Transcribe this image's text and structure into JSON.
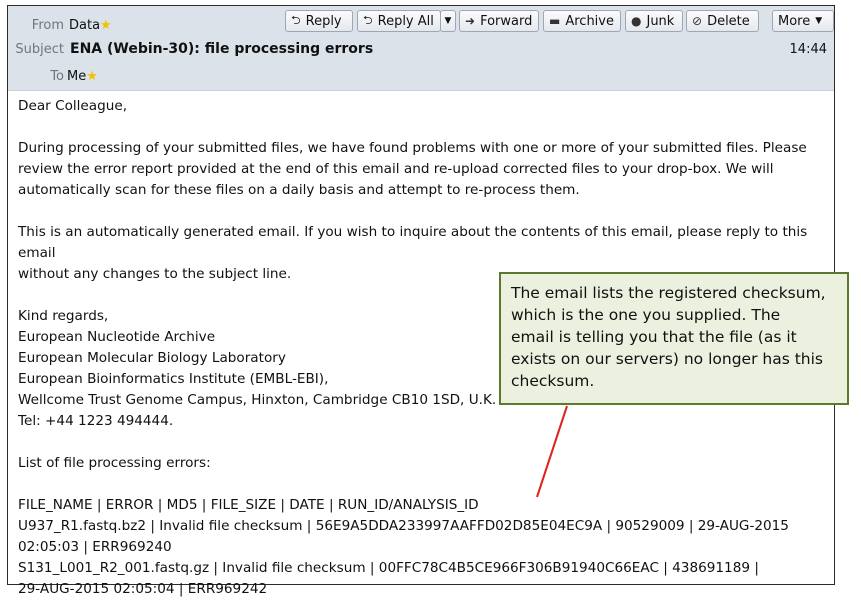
{
  "header": {
    "from_label": "From",
    "from_value": "Data",
    "subject_label": "Subject",
    "subject_value": "ENA (Webin-30): file processing errors",
    "to_label": "To",
    "to_value": "Me",
    "time": "14:44",
    "star_icon": "star"
  },
  "toolbar": {
    "reply": "Reply",
    "reply_all": "Reply All",
    "forward": "Forward",
    "archive": "Archive",
    "junk": "Junk",
    "delete": "Delete",
    "more": "More"
  },
  "body": {
    "greeting": "Dear Colleague,",
    "para1_lines": [
      "During processing of your submitted files, we have found problems with one or more of your submitted files. Please",
      "review the error report provided at the end of this email and re-upload corrected files to your drop-box. We will",
      "automatically scan for these files on a daily basis and attempt to re-process them."
    ],
    "para2_lines": [
      "This is an automatically generated email. If you wish to inquire about the contents of this email, please reply to this email",
      "without any changes to the subject line."
    ],
    "signature_lines": [
      "Kind regards,",
      "European Nucleotide Archive",
      "European Molecular Biology Laboratory",
      "European Bioinformatics Institute (EMBL-EBI),",
      "Wellcome Trust Genome Campus, Hinxton, Cambridge CB10 1SD, U.K.",
      "Tel: +44 1223 494444."
    ],
    "errors_heading": "List of file processing errors:",
    "errors_lines": [
      "FILE_NAME | ERROR | MD5 | FILE_SIZE | DATE | RUN_ID/ANALYSIS_ID",
      "U937_R1.fastq.bz2 | Invalid file checksum | 56E9A5DDA233997AAFFD02D85E04EC9A | 90529009 | 29-AUG-2015",
      "02:05:03 | ERR969240",
      "S131_L001_R2_001.fastq.gz | Invalid file checksum | 00FFC78C4B5CE966F306B91940C66EAC | 438691189 |",
      "29-AUG-2015 02:05:04 | ERR969242"
    ]
  },
  "callout": {
    "lines": [
      "The email lists the registered checksum,",
      "which is the one you supplied. The",
      "email is telling you that the file (as it",
      "exists on our servers) no longer has this",
      "checksum."
    ],
    "border_color": "#5b7a2e",
    "fill_color": "#ebf1de",
    "arrow_color": "#e0201b"
  }
}
